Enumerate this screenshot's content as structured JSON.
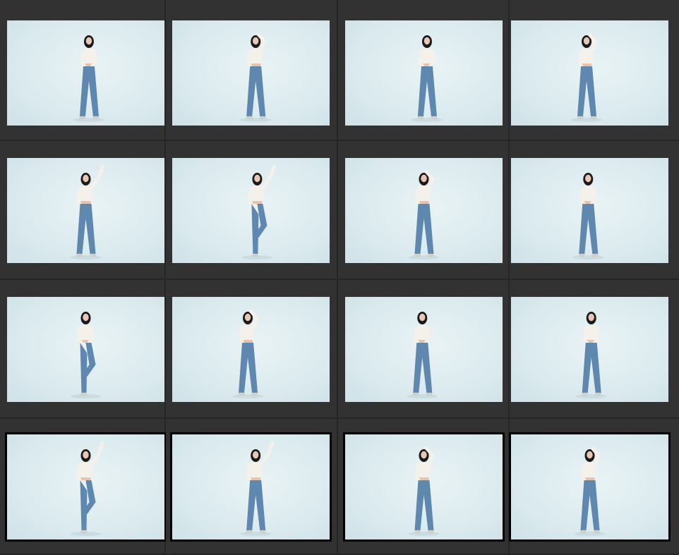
{
  "colors": {
    "background": "#2b2b2b",
    "cell": "#323232",
    "photo_backdrop": "#dcebef",
    "jeans": "#5f88b0",
    "top": "#f4f1ea",
    "hair": "#1c1a1a",
    "selection": "#000000"
  },
  "photos": [
    {
      "pose": "stand-hand-chest",
      "x": 0.52,
      "selected": false
    },
    {
      "pose": "hand-on-head",
      "x": 0.53,
      "selected": false
    },
    {
      "pose": "stand-hand-chest",
      "x": 0.52,
      "selected": false
    },
    {
      "pose": "hand-on-head",
      "x": 0.48,
      "selected": false
    },
    {
      "pose": "arm-raised",
      "x": 0.5,
      "selected": false
    },
    {
      "pose": "arm-raised-leg-up",
      "x": 0.54,
      "selected": false
    },
    {
      "pose": "hand-on-head",
      "x": 0.5,
      "selected": false
    },
    {
      "pose": "stand-hand-chest",
      "x": 0.49,
      "selected": false
    },
    {
      "pose": "leg-up",
      "x": 0.5,
      "selected": false
    },
    {
      "pose": "hand-on-head",
      "x": 0.48,
      "selected": false
    },
    {
      "pose": "stand-hand-chest",
      "x": 0.49,
      "selected": false
    },
    {
      "pose": "stand-hand-chest",
      "x": 0.51,
      "selected": false
    },
    {
      "pose": "arm-raised-leg-up",
      "x": 0.5,
      "selected": true
    },
    {
      "pose": "arm-raised",
      "x": 0.53,
      "selected": true
    },
    {
      "pose": "hand-on-head",
      "x": 0.5,
      "selected": true
    },
    {
      "pose": "hand-on-head",
      "x": 0.5,
      "selected": true
    }
  ]
}
